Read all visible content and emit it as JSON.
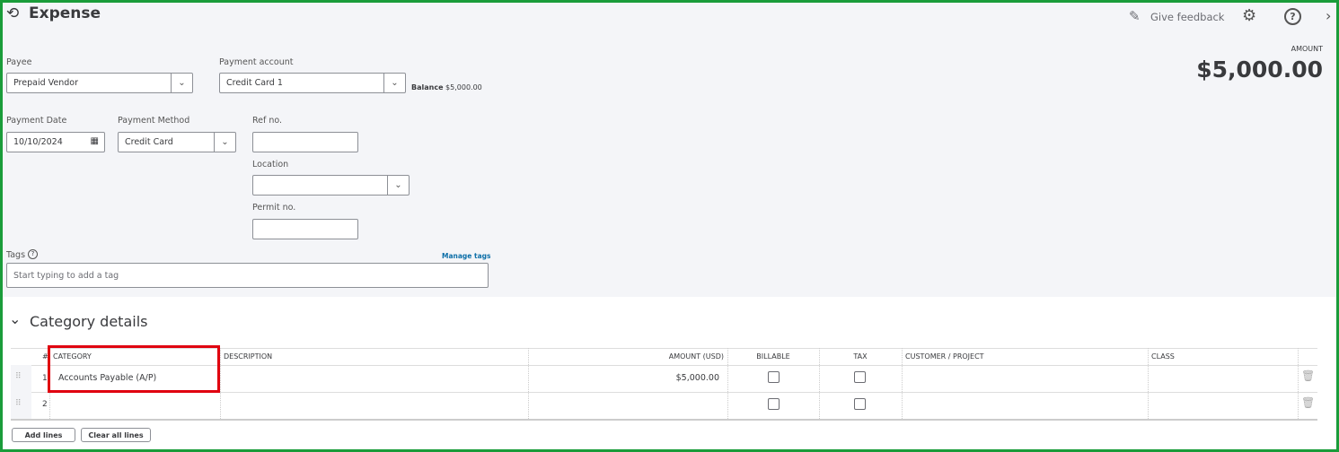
{
  "header": {
    "title": "Expense",
    "give_feedback": "Give feedback",
    "amount_label": "AMOUNT",
    "amount": "$5,000.00"
  },
  "form": {
    "payee_label": "Payee",
    "payee": "Prepaid Vendor",
    "payment_account_label": "Payment account",
    "payment_account": "Credit Card 1",
    "balance_label": "Balance",
    "balance": "$5,000.00",
    "payment_date_label": "Payment Date",
    "payment_date": "10/10/2024",
    "payment_method_label": "Payment Method",
    "payment_method": "Credit Card",
    "ref_label": "Ref no.",
    "ref": "",
    "location_label": "Location",
    "location": "",
    "permit_label": "Permit no.",
    "permit": "",
    "tags_label": "Tags",
    "manage_tags": "Manage tags",
    "tags_placeholder": "Start typing to add a tag"
  },
  "category": {
    "title": "Category details",
    "columns": [
      "#",
      "CATEGORY",
      "DESCRIPTION",
      "AMOUNT (USD)",
      "BILLABLE",
      "TAX",
      "CUSTOMER / PROJECT",
      "CLASS"
    ],
    "rows": [
      {
        "num": "1",
        "category": "Accounts Payable (A/P)",
        "description": "",
        "amount": "$5,000.00"
      },
      {
        "num": "2",
        "category": "",
        "description": "",
        "amount": ""
      }
    ],
    "add_lines": "Add lines",
    "clear_lines": "Clear all lines"
  }
}
